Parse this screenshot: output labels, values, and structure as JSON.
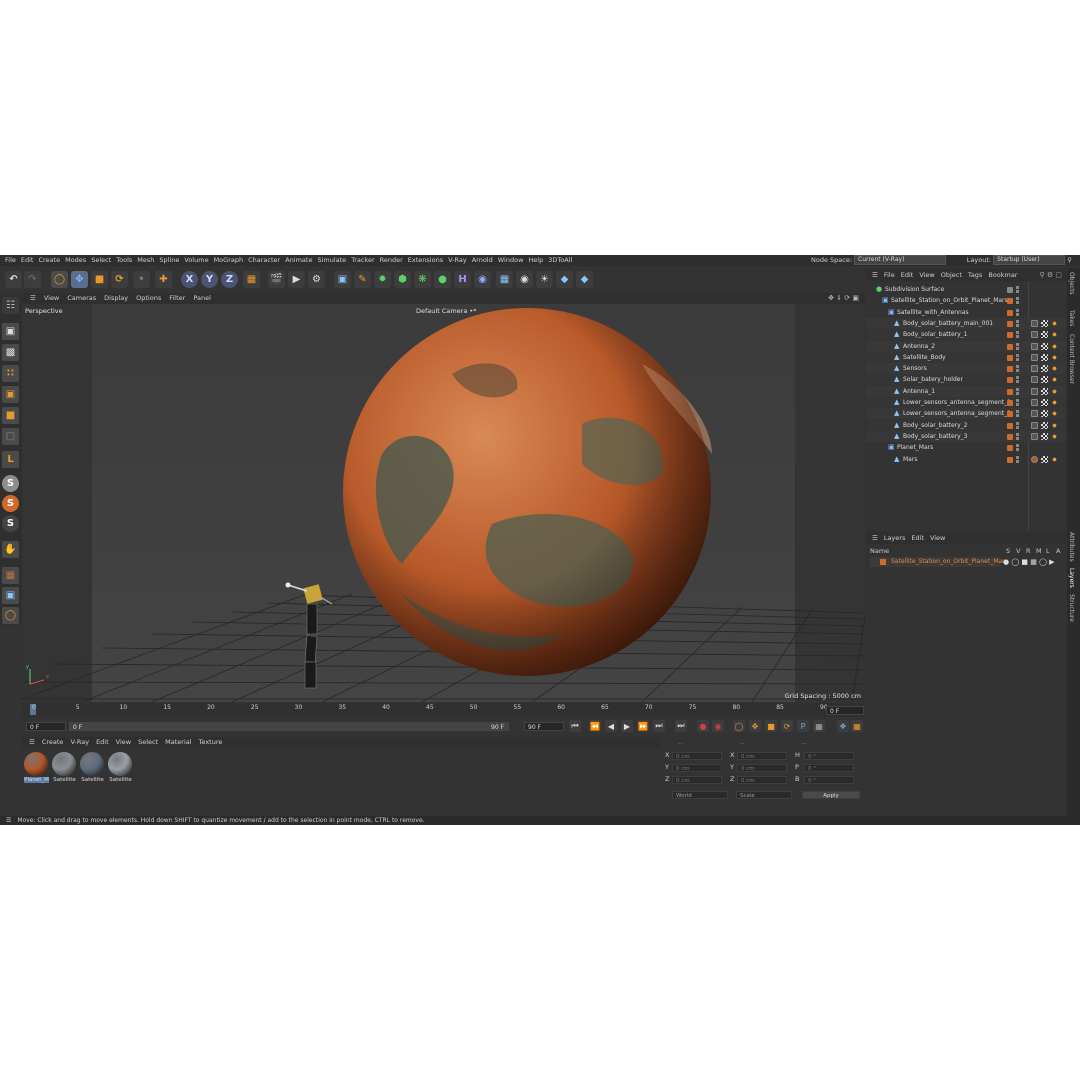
{
  "menubar": {
    "items": [
      "File",
      "Edit",
      "Create",
      "Modes",
      "Select",
      "Tools",
      "Mesh",
      "Spline",
      "Volume",
      "MoGraph",
      "Character",
      "Animate",
      "Simulate",
      "Tracker",
      "Render",
      "Extensions",
      "V-Ray",
      "Arnold",
      "Window",
      "Help",
      "3DToAll"
    ],
    "node_space_label": "Node Space:",
    "node_space_value": "Current (V-Ray)",
    "layout_label": "Layout:",
    "layout_value": "Startup (User)"
  },
  "viewport": {
    "menu": [
      "View",
      "Cameras",
      "Display",
      "Options",
      "Filter",
      "Panel"
    ],
    "view_name": "Perspective",
    "camera": "Default Camera •*",
    "grid_spacing": "Grid Spacing : 5000 cm",
    "axis_y": "y",
    "axis_x": "x"
  },
  "timeline": {
    "ticks": [
      "0",
      "5",
      "10",
      "15",
      "20",
      "25",
      "30",
      "35",
      "40",
      "45",
      "50",
      "55",
      "60",
      "65",
      "70",
      "75",
      "80",
      "85",
      "90"
    ],
    "current_frame": "0 F",
    "start_frame": "0 F",
    "end_frame": "90 F",
    "end_frame2": "90 F",
    "max_frame": "90 F",
    "frame_right": "0 F"
  },
  "materials": {
    "menu": [
      "Create",
      "V-Ray",
      "Edit",
      "View",
      "Select",
      "Material",
      "Texture"
    ],
    "items": [
      {
        "label": "Planet_M",
        "color": "#b5562a"
      },
      {
        "label": "Satellite",
        "color": "#8a8f96"
      },
      {
        "label": "Satellite",
        "color": "#5d6d7e"
      },
      {
        "label": "Satellite",
        "color": "#9aa0a8"
      }
    ]
  },
  "coords": {
    "headers": [
      "--",
      "--",
      "--"
    ],
    "rows": [
      {
        "a": "X",
        "av": "0 cm",
        "b": "X",
        "bv": "0 cm",
        "c": "H",
        "cv": "0 °"
      },
      {
        "a": "Y",
        "av": "0 cm",
        "b": "Y",
        "bv": "0 cm",
        "c": "P",
        "cv": "0 °"
      },
      {
        "a": "Z",
        "av": "0 cm",
        "b": "Z",
        "bv": "0 cm",
        "c": "B",
        "cv": "0 °"
      }
    ],
    "mode1": "World",
    "mode2": "Scale",
    "apply": "Apply"
  },
  "status": "Move: Click and drag to move elements. Hold down SHIFT to quantize movement / add to the selection in point mode, CTRL to remove.",
  "objects": {
    "menu": [
      "File",
      "Edit",
      "View",
      "Object",
      "Tags",
      "Bookmar"
    ],
    "rows": [
      {
        "name": "Subdivision Surface",
        "indent": 0,
        "kind": "subd"
      },
      {
        "name": "Satellite_Station_on_Orbit_Planet_Mars",
        "indent": 1,
        "kind": "null"
      },
      {
        "name": "Satellite_with_Antennas",
        "indent": 2,
        "kind": "null"
      },
      {
        "name": "Body_solar_battery_main_001",
        "indent": 3,
        "kind": "poly"
      },
      {
        "name": "Body_solar_battery_1",
        "indent": 3,
        "kind": "poly"
      },
      {
        "name": "Antenna_2",
        "indent": 3,
        "kind": "poly"
      },
      {
        "name": "Satellite_Body",
        "indent": 3,
        "kind": "poly"
      },
      {
        "name": "Sensors",
        "indent": 3,
        "kind": "poly"
      },
      {
        "name": "Solar_batery_holder",
        "indent": 3,
        "kind": "poly"
      },
      {
        "name": "Antenna_1",
        "indent": 3,
        "kind": "poly"
      },
      {
        "name": "Lower_sensors_antenna_segment_1",
        "indent": 3,
        "kind": "poly"
      },
      {
        "name": "Lower_sensors_antenna_segment_2",
        "indent": 3,
        "kind": "poly"
      },
      {
        "name": "Body_solar_battery_2",
        "indent": 3,
        "kind": "poly"
      },
      {
        "name": "Body_solar_battery_3",
        "indent": 3,
        "kind": "poly"
      },
      {
        "name": "Planet_Mars",
        "indent": 2,
        "kind": "null"
      },
      {
        "name": "Mars",
        "indent": 3,
        "kind": "poly"
      }
    ]
  },
  "layers": {
    "menu": [
      "Layers",
      "Edit",
      "View"
    ],
    "header_name": "Name",
    "header_flags": [
      "S",
      "V",
      "R",
      "M",
      "L",
      "A"
    ],
    "rows": [
      {
        "name": "Satellite_Station_on_Orbit_Planet_Mars",
        "color": "#d06a2a"
      }
    ]
  },
  "sidetabs": [
    "Objects",
    "Takes",
    "Content Browser",
    "Attributes",
    "Layers",
    "Structure"
  ],
  "colors": {
    "accent": "#d06a2a",
    "panel": "#333333",
    "viewport": "#3a3a3a",
    "mars": "#c4622d"
  }
}
